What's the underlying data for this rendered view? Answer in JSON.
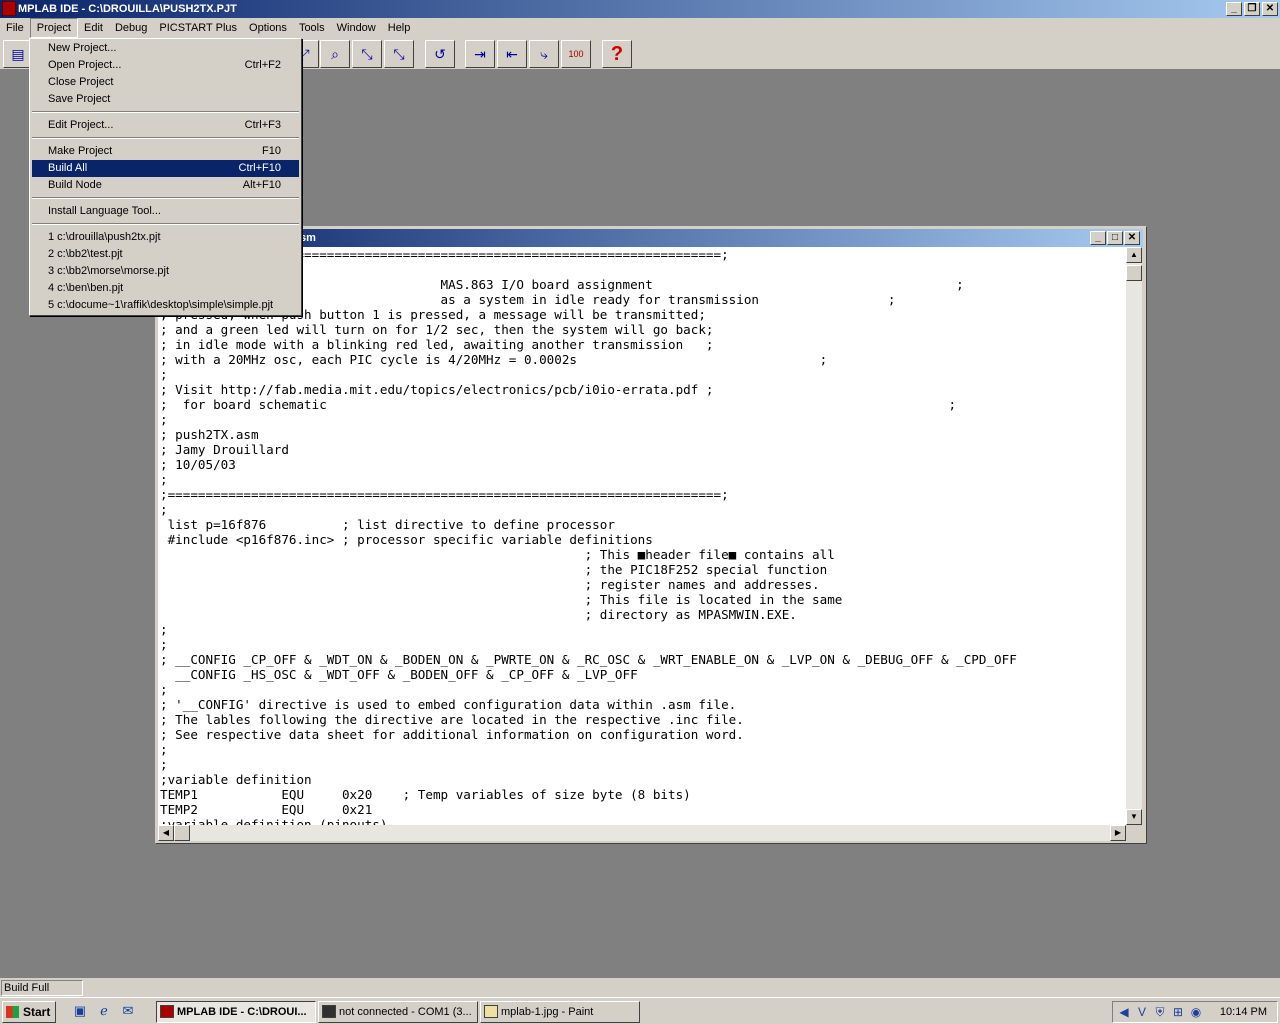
{
  "app": {
    "title": "MPLAB IDE - C:\\DROUILLA\\PUSH2TX.PJT"
  },
  "menubar": [
    "File",
    "Project",
    "Edit",
    "Debug",
    "PICSTART Plus",
    "Options",
    "Tools",
    "Window",
    "Help"
  ],
  "project_menu": [
    {
      "label": "New Project...",
      "shortcut": ""
    },
    {
      "label": "Open Project...",
      "shortcut": "Ctrl+F2"
    },
    {
      "label": "Close Project",
      "shortcut": ""
    },
    {
      "label": "Save Project",
      "shortcut": ""
    },
    {
      "label": "Edit Project...",
      "shortcut": "Ctrl+F3"
    },
    {
      "label": "Make Project",
      "shortcut": "F10"
    },
    {
      "label": "Build All",
      "shortcut": "Ctrl+F10",
      "highlighted": true
    },
    {
      "label": "Build Node",
      "shortcut": "Alt+F10"
    },
    {
      "label": "Install Language Tool...",
      "shortcut": ""
    },
    {
      "label": "1 c:\\drouilla\\push2tx.pjt",
      "shortcut": ""
    },
    {
      "label": "2 c:\\bb2\\test.pjt",
      "shortcut": ""
    },
    {
      "label": "3 c:\\bb2\\morse\\morse.pjt",
      "shortcut": ""
    },
    {
      "label": "4 c:\\ben\\ben.pjt",
      "shortcut": ""
    },
    {
      "label": "5 c:\\docume~1\\raffik\\desktop\\simple\\simple.pjt",
      "shortcut": ""
    }
  ],
  "editor": {
    "title_visible": "sm",
    "code": ";=========================================================================;\n;\n;                                    MAS.863 I/O board assignment                                        ;\n; ...                                as a system in idle ready for transmission                 ;\n; pressed, when push button 1 is pressed, a message will be transmitted;\n; and a green led will turn on for 1/2 sec, then the system will go back;\n; in idle mode with a blinking red led, awaiting another transmission   ;\n; with a 20MHz osc, each PIC cycle is 4/20MHz = 0.0002s                                ;\n;\n; Visit http://fab.media.mit.edu/topics/electronics/pcb/i0io-errata.pdf ;\n;  for board schematic                                                                                  ;\n;\n; push2TX.asm\n; Jamy Drouillard\n; 10/05/03\n;\n;=========================================================================;\n;\n list p=16f876          ; list directive to define processor\n #include <p16f876.inc> ; processor specific variable definitions\n                                                        ; This ■header file■ contains all\n                                                        ; the PIC18F252 special function\n                                                        ; register names and addresses.\n                                                        ; This file is located in the same\n                                                        ; directory as MPASMWIN.EXE.\n;\n;\n; __CONFIG _CP_OFF & _WDT_ON & _BODEN_ON & _PWRTE_ON & _RC_OSC & _WRT_ENABLE_ON & _LVP_ON & _DEBUG_OFF & _CPD_OFF\n  __CONFIG _HS_OSC & _WDT_OFF & _BODEN_OFF & _CP_OFF & _LVP_OFF\n;\n; '__CONFIG' directive is used to embed configuration data within .asm file.\n; The lables following the directive are located in the respective .inc file.\n; See respective data sheet for additional information on configuration word.\n;\n;\n;variable definition\nTEMP1           EQU     0x20    ; Temp variables of size byte (8 bits)\nTEMP2           EQU     0x21\n;variable definition (pinouts)"
  },
  "statusbar": {
    "text": "Build Full Project"
  },
  "taskbar": {
    "start": "Start",
    "tasks": [
      "MPLAB IDE - C:\\DROUI...",
      "not connected - COM1 (3...",
      "mplab-1.jpg - Paint"
    ],
    "clock": "10:14 PM"
  }
}
